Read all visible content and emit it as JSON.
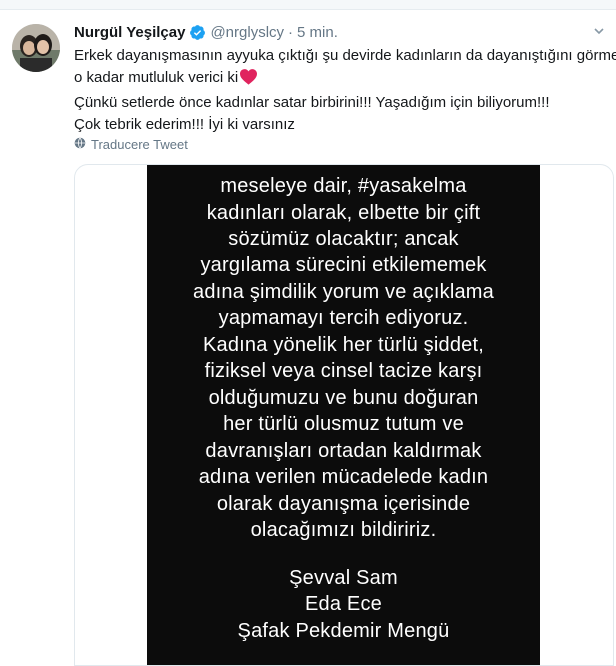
{
  "tweet": {
    "author_name": "Nurgül Yeşilçay",
    "handle": "@nrglyslcy",
    "separator": "·",
    "time": "5 min.",
    "lines": [
      "Erkek dayanışmasının ayyuka çıktığı şu devirde kadınların da dayanıştığını görmek",
      "o kadar mutluluk verici ki",
      "Çünkü setlerde önce kadınlar satar birbirini!!! Yaşadığım için biliyorum!!!",
      "Çok tebrik ederim!!! İyi ki varsınız"
    ],
    "translate_label": "Traducere Tweet"
  },
  "media": {
    "story_lines": [
      "meseleye dair, #yasakelma",
      "kadınları olarak, elbette bir çift",
      "sözümüz olacaktır; ancak",
      "yargılama sürecini etkilememek",
      "adına şimdilik yorum ve açıklama",
      "yapmamayı tercih ediyoruz.",
      "Kadına yönelik her türlü şiddet,",
      "fiziksel veya cinsel tacize karşı",
      "olduğumuzu ve bunu doğuran",
      "her türlü olusmuz tutum ve",
      "davranışları ortadan kaldırmak",
      "adına verilen mücadelede kadın",
      "olarak dayanışma içerisinde",
      "olacağımızı bildiririz."
    ],
    "signatures": [
      "Şevval Sam",
      "Eda Ece",
      "Şafak Pekdemir Mengü"
    ]
  },
  "colors": {
    "verified": "#1da1f2",
    "heart": "#e0245e",
    "muted": "#657786",
    "story_bg": "#0c0c0c"
  },
  "icons": [
    "verified-badge-icon",
    "heart-emoji-icon",
    "globe-icon",
    "chevron-down-icon"
  ]
}
